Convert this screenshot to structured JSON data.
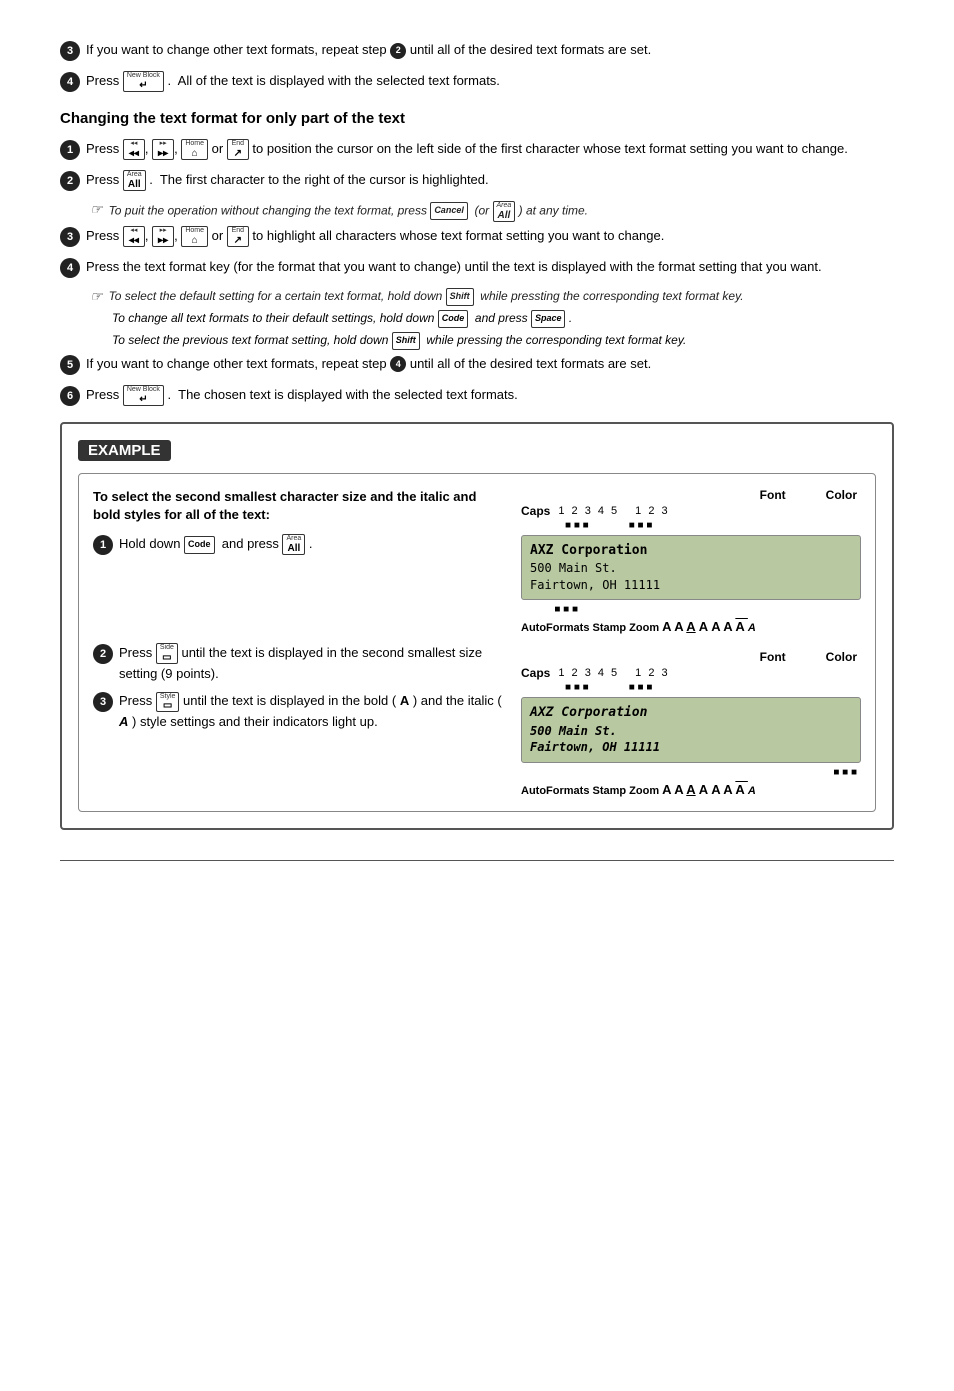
{
  "page": {
    "section1": {
      "step3": "If you want to change other text formats, repeat step",
      "step3_bold": "❷",
      "step3_end": "until all of the desired text formats are set.",
      "step4": "Press",
      "step4_mid": ". All of the text is displayed with the selected text formats."
    },
    "section2": {
      "heading": "Changing the text format for only part of the text",
      "s1": "Press",
      "s1_mid": ",",
      "s1_end": "or",
      "s1_final": "to position the cursor on the left side of the first character whose text format setting you want to change.",
      "s2": "Press",
      "s2_end": ". The first character to the right of the cursor is highlighted.",
      "note1": "To puit the operation without changing the text format, press",
      "note1_mid": "(or",
      "note1_end": ") at any time.",
      "s3": "Press",
      "s3_end": "or",
      "s3_final": "to highlight all characters whose text format setting you want to change.",
      "s4": "Press the text format key (for the format that you want to change) until the text is displayed with the format setting that you want.",
      "note2": "To select the default setting for a certain text format, hold down",
      "note2_end": "while pressting the corresponding text format key.",
      "note3": "To change all text formats to their default settings, hold down",
      "note3_mid": "and press",
      "note3_end": ".",
      "note4": "To select the previous text format setting, hold down",
      "note4_end": "while pressing the corresponding text format key.",
      "s5": "If you want to change other text formats, repeat step",
      "s5_bold": "❹",
      "s5_end": "until all of the desired text formats are set.",
      "s6": "Press",
      "s6_end": ". The chosen text is displayed with the selected text formats."
    },
    "example": {
      "label": "EXAMPLE",
      "heading": "To select the second smallest character size and the italic and bold styles for all of the text:",
      "step1_label": "❶",
      "step1": "Hold down",
      "step1_mid": "and press",
      "step2_label": "❷",
      "step2": "Press",
      "step2_end": "until the text is displayed in the second smallest size setting (9 points).",
      "step3_label": "❸",
      "step3": "Press",
      "step3_end": "until the text is displayed in the bold (",
      "step3_bold_a": "A",
      "step3_end2": ") and the italic (",
      "step3_italic_a": "A",
      "step3_end3": ") style settings and their indicators light up.",
      "lcd1_lines": [
        "AXZ Corporation",
        "500 Main St.",
        "Fairtown, OH 11111"
      ],
      "lcd2_lines": [
        "AXZ Corporation",
        "500 Main St.",
        "Fairtown, OH 11111"
      ],
      "font_label": "Font",
      "color_label": "Color",
      "caps_label": "Caps",
      "font_nums": "1 2 3 4 5",
      "color_nums": "1 2 3",
      "autoformats_label": "AutoFormats Stamp Zoom"
    }
  }
}
